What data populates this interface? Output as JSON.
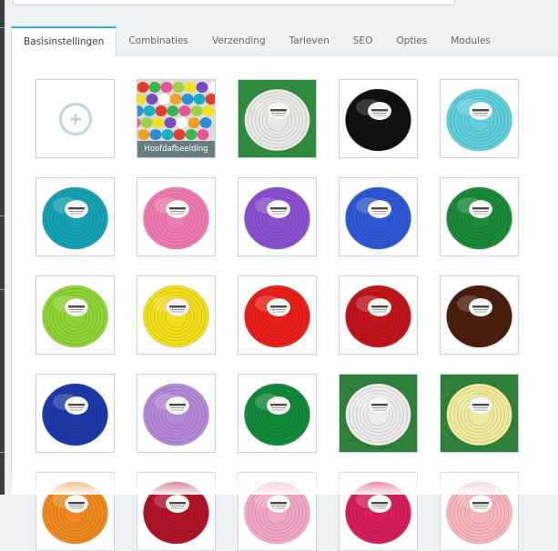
{
  "tabs": [
    {
      "label": "Basisinstellingen",
      "active": true
    },
    {
      "label": "Combinaties"
    },
    {
      "label": "Verzending"
    },
    {
      "label": "Tarieven"
    },
    {
      "label": "SEO"
    },
    {
      "label": "Opties"
    },
    {
      "label": "Modules"
    }
  ],
  "gallery": {
    "cover_label": "Hoofdafbeelding",
    "add_icon": "plus-circle-icon",
    "images": [
      {
        "color": "#e8e8e6",
        "bg": "#2e8b3e"
      },
      {
        "color": "#111111",
        "bg": "#ffffff"
      },
      {
        "color": "#5fd0dd",
        "bg": "#ffffff"
      },
      {
        "color": "#13a3b5",
        "bg": "#ffffff"
      },
      {
        "color": "#f07ab0",
        "bg": "#ffffff"
      },
      {
        "color": "#8b4fcf",
        "bg": "#ffffff"
      },
      {
        "color": "#2f58d6",
        "bg": "#ffffff"
      },
      {
        "color": "#1a8a3a",
        "bg": "#ffffff"
      },
      {
        "color": "#8fd334",
        "bg": "#ffffff"
      },
      {
        "color": "#f4e01a",
        "bg": "#ffffff"
      },
      {
        "color": "#ec1e1a",
        "bg": "#ffffff"
      },
      {
        "color": "#c2151b",
        "bg": "#ffffff"
      },
      {
        "color": "#4b1e0e",
        "bg": "#ffffff"
      },
      {
        "color": "#1e3aa8",
        "bg": "#ffffff"
      },
      {
        "color": "#b688d8",
        "bg": "#ffffff"
      },
      {
        "color": "#128a3a",
        "bg": "#ffffff"
      },
      {
        "color": "#ededed",
        "bg": "#2e7f3a"
      },
      {
        "color": "#f0ec9a",
        "bg": "#2e7f3a"
      },
      {
        "color": "#f08a1e",
        "bg": "#ffffff"
      },
      {
        "color": "#b0132a",
        "bg": "#ffffff"
      },
      {
        "color": "#f2a6c8",
        "bg": "#ffffff"
      },
      {
        "color": "#d81e5a",
        "bg": "#ffffff"
      },
      {
        "color": "#f7b5b9",
        "bg": "#ffffff"
      }
    ]
  }
}
